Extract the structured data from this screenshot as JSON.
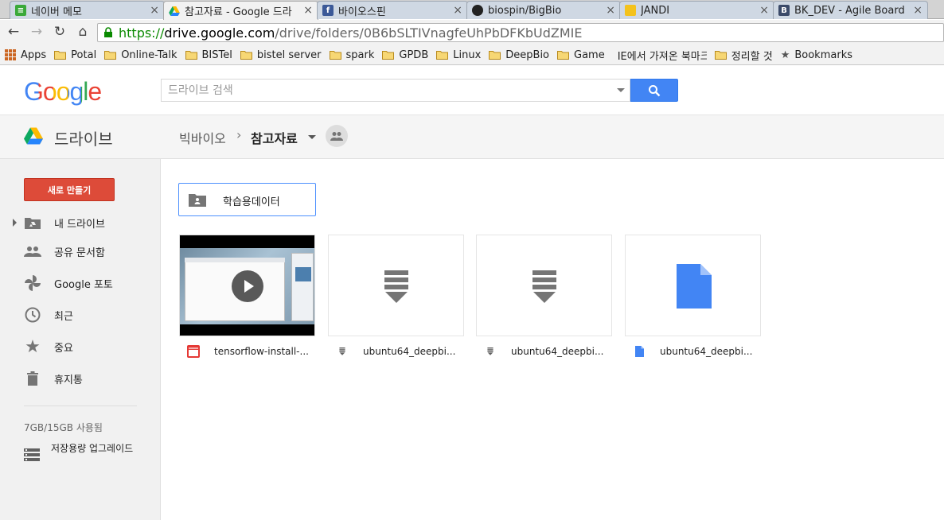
{
  "browser": {
    "tabs": [
      {
        "title": "네이버 메모",
        "icon": "naver-memo-icon",
        "active": false
      },
      {
        "title": "참고자료 - Google 드라",
        "icon": "google-drive-icon",
        "active": true
      },
      {
        "title": "바이오스핀",
        "icon": "facebook-icon",
        "active": false
      },
      {
        "title": "biospin/BigBio",
        "icon": "github-icon",
        "active": false
      },
      {
        "title": "JANDI",
        "icon": "jandi-icon",
        "active": false
      },
      {
        "title": "BK_DEV - Agile Board",
        "icon": "bitbucket-icon",
        "active": false
      }
    ],
    "url_scheme": "https://",
    "url_host": "drive.google.com",
    "url_path": "/drive/folders/0B6bSLTIVnagfeUhPbDFKbUdZMIE",
    "bookmarks": [
      "Apps",
      "Potal",
      "Online-Talk",
      "BISTel",
      "bistel server",
      "spark",
      "GPDB",
      "Linux",
      "DeepBio",
      "Game",
      "IE에서 가져온 북마크",
      "정리할 것",
      "Bookmarks"
    ]
  },
  "header": {
    "logo_text": "Google",
    "search_placeholder": "드라이브 검색"
  },
  "drive": {
    "title": "드라이브",
    "breadcrumb": {
      "parent": "빅바이오",
      "current": "참고자료"
    }
  },
  "sidebar": {
    "new_button": "새로 만들기",
    "items": [
      {
        "label": "내 드라이브",
        "icon": "my-drive-icon"
      },
      {
        "label": "공유 문서함",
        "icon": "shared-icon"
      },
      {
        "label": "Google 포토",
        "icon": "photos-icon"
      },
      {
        "label": "최근",
        "icon": "clock-icon"
      },
      {
        "label": "중요",
        "icon": "star-icon"
      },
      {
        "label": "휴지통",
        "icon": "trash-icon"
      }
    ],
    "storage": "7GB/15GB 사용됨",
    "upgrade": "저장용량 업그레이드"
  },
  "content": {
    "folders": [
      {
        "name": "학습용데이터",
        "icon": "shared-folder-icon"
      }
    ],
    "files": [
      {
        "name": "tensorflow-install-...",
        "type": "video",
        "type_icon": "video-file-icon"
      },
      {
        "name": "ubuntu64_deepbi...",
        "type": "binary",
        "type_icon": "download-file-icon"
      },
      {
        "name": "ubuntu64_deepbi...",
        "type": "binary",
        "type_icon": "download-file-icon"
      },
      {
        "name": "ubuntu64_deepbi...",
        "type": "document",
        "type_icon": "document-file-icon"
      }
    ]
  },
  "colors": {
    "new_button": "#dd4b39",
    "search_button": "#4285f4",
    "selected_border": "#4d90fe",
    "https_green": "#0a8a00"
  }
}
